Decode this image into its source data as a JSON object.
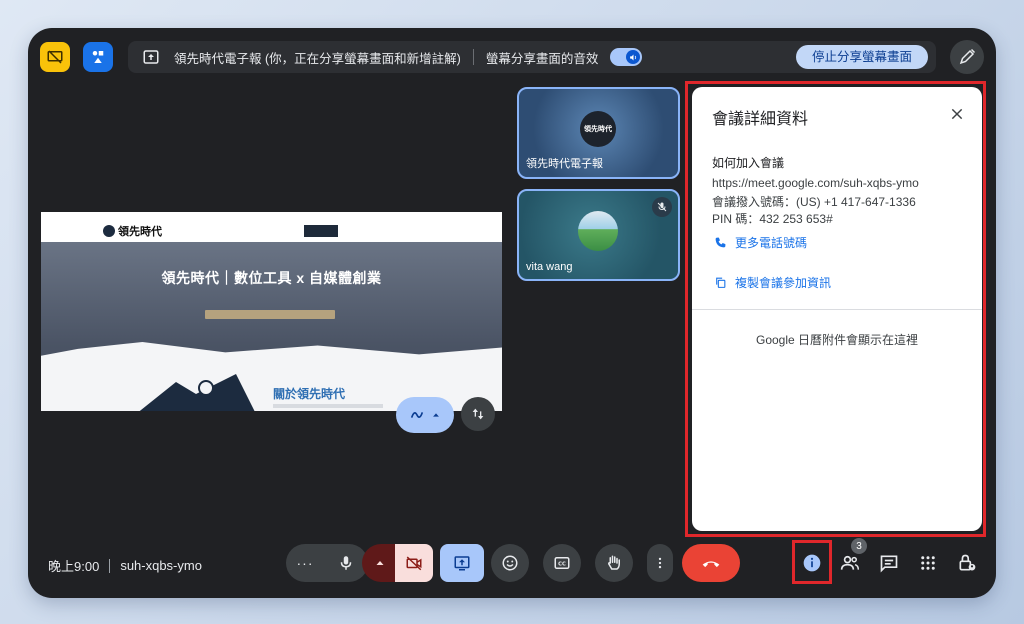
{
  "share_bar": {
    "text": "領先時代電子報 (你，正在分享螢幕畫面和新增註解)",
    "audio_label": "螢幕分享畫面的音效",
    "stop_label": "停止分享螢幕畫面"
  },
  "presentation": {
    "logo": "領先時代",
    "hero_title": "領先時代｜數位工具 x 自媒體創業",
    "about_title": "關於領先時代"
  },
  "participants": [
    {
      "name": "領先時代電子報",
      "avatar_text": "領先時代"
    },
    {
      "name": "vita wang",
      "muted": true
    }
  ],
  "details_panel": {
    "title": "會議詳細資料",
    "how_to_join": "如何加入會議",
    "meeting_url": "https://meet.google.com/suh-xqbs-ymo",
    "dial_in": "會議撥入號碼：(US) +1 417-647-1336",
    "pin": "PIN 碼：432 253 653#",
    "more_phones": "更多電話號碼",
    "copy_info": "複製會議參加資訊",
    "calendar_note": "Google 日曆附件會顯示在這裡"
  },
  "bottom_bar": {
    "time": "晚上9:00",
    "meeting_code": "suh-xqbs-ymo",
    "people_count": "3"
  },
  "colors": {
    "end_call": "#ea4335",
    "accent_blue": "#a8c7fa",
    "highlight_frame": "#e0272b",
    "link": "#1a73e8"
  }
}
